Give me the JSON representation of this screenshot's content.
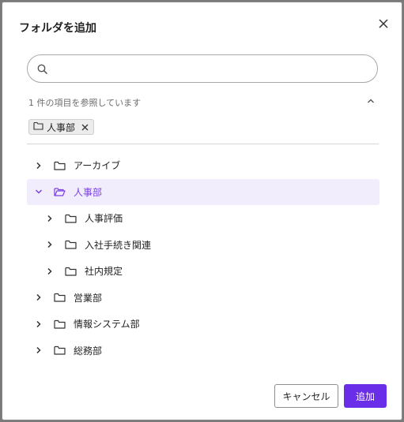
{
  "dialog": {
    "title": "フォルダを追加"
  },
  "search": {
    "value": "",
    "placeholder": ""
  },
  "summary": "1 件の項目を参照しています",
  "chip": {
    "label": "人事部"
  },
  "tree": [
    {
      "label": "アーカイブ",
      "level": 0,
      "expanded": false,
      "selected": false
    },
    {
      "label": "人事部",
      "level": 0,
      "expanded": true,
      "selected": true
    },
    {
      "label": "人事評価",
      "level": 1,
      "expanded": false,
      "selected": false
    },
    {
      "label": "入社手続き関連",
      "level": 1,
      "expanded": false,
      "selected": false
    },
    {
      "label": "社内規定",
      "level": 1,
      "expanded": false,
      "selected": false
    },
    {
      "label": "営業部",
      "level": 0,
      "expanded": false,
      "selected": false
    },
    {
      "label": "情報システム部",
      "level": 0,
      "expanded": false,
      "selected": false
    },
    {
      "label": "総務部",
      "level": 0,
      "expanded": false,
      "selected": false
    }
  ],
  "buttons": {
    "cancel": "キャンセル",
    "add": "追加"
  },
  "colors": {
    "accent": "#6b2ee8",
    "selected_bg": "#f1edfd",
    "selected_text": "#7b3fe4"
  }
}
